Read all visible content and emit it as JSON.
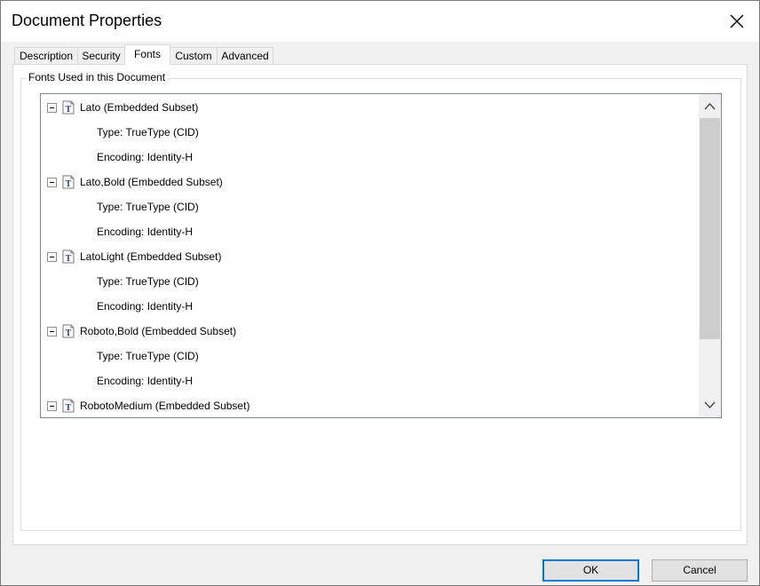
{
  "window": {
    "title": "Document Properties"
  },
  "tabs": [
    {
      "label": "Description",
      "active": false
    },
    {
      "label": "Security",
      "active": false
    },
    {
      "label": "Fonts",
      "active": true
    },
    {
      "label": "Custom",
      "active": false
    },
    {
      "label": "Advanced",
      "active": false
    }
  ],
  "fonts_group": {
    "label": "Fonts Used in this Document",
    "fonts": [
      {
        "name": "Lato (Embedded Subset)",
        "type": "Type: TrueType (CID)",
        "encoding": "Encoding: Identity-H",
        "expanded": true
      },
      {
        "name": "Lato,Bold (Embedded Subset)",
        "type": "Type: TrueType (CID)",
        "encoding": "Encoding: Identity-H",
        "expanded": true
      },
      {
        "name": "LatoLight (Embedded Subset)",
        "type": "Type: TrueType (CID)",
        "encoding": "Encoding: Identity-H",
        "expanded": true
      },
      {
        "name": "Roboto,Bold (Embedded Subset)",
        "type": "Type: TrueType (CID)",
        "encoding": "Encoding: Identity-H",
        "expanded": true
      },
      {
        "name": "RobotoMedium (Embedded Subset)",
        "expanded": true
      }
    ]
  },
  "buttons": {
    "ok": "OK",
    "cancel": "Cancel"
  },
  "icons": {
    "close": "close-icon",
    "font": "truetype-font-icon",
    "collapse": "collapse-icon",
    "scroll_up": "chevron-up-icon",
    "scroll_down": "chevron-down-icon"
  },
  "colors": {
    "accent": "#0078d7",
    "font_icon_blue": "#1f3fa8",
    "panel_bg": "#ffffff",
    "window_bg": "#f0f0f0"
  }
}
